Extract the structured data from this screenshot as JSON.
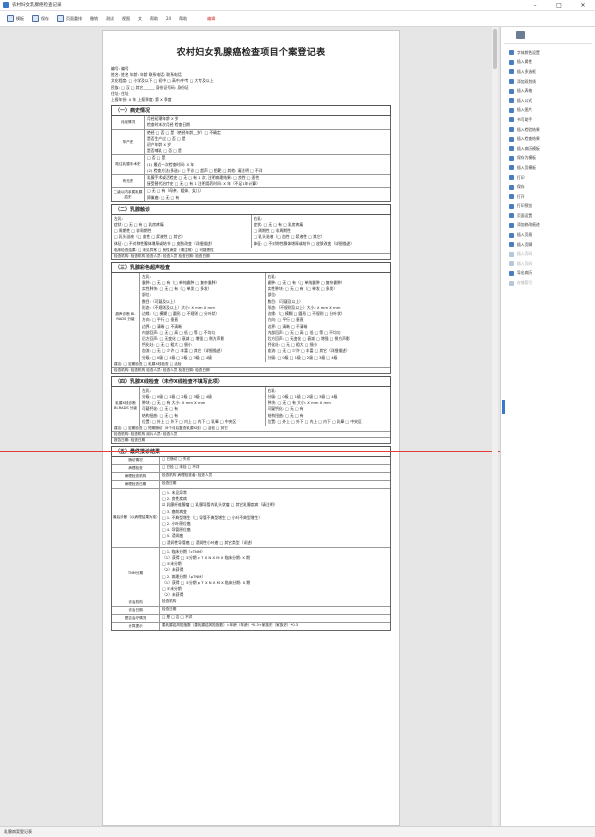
{
  "window": {
    "title": "农村妇女乳腺癌检查记录",
    "minimize": "–",
    "maximize": "□",
    "close": "✕"
  },
  "toolbar": {
    "items": [
      {
        "label": "模板"
      },
      {
        "label": "保存"
      },
      {
        "label": "页面重排"
      },
      {
        "label": "撤销"
      },
      {
        "label": "测试"
      },
      {
        "label": "视图"
      },
      {
        "label": "文"
      },
      {
        "label": "帮助"
      },
      {
        "label": "24"
      },
      {
        "label": "帮助"
      }
    ],
    "red_item": "编辑"
  },
  "document": {
    "title": "农村妇女乳腺癌检查项目个案登记表",
    "header_lines": [
      "编号: 编号",
      "姓名: 姓名            年龄: 年龄            联系电话: 联系电话",
      "文化程度: □ 小学及以下 □ 初中 □ 高中/中专 □ 大专及以上",
      "民族: □ 汉 □ 其它______          身份证号码: 身份证",
      "住址: 住址",
      "上报年份: X 年            上报季度: 第 X 季度"
    ],
    "sections": {
      "s1": "（一）病史情况",
      "s2": "（二）乳腺触诊",
      "s3": "（三）乳腺彩色超声检查",
      "s4": "（四）乳腺X线检查（未作X线检查不填写此项）",
      "s5": "（五）最终接诊结果"
    },
    "s1_rows": [
      {
        "label": "月经情况",
        "items": [
          "月经初潮年龄  X  岁",
          "检查时末次月经  检查日期"
        ]
      },
      {
        "label": "孕产史",
        "items": [
          "绝经  □ 否 □ 是（绝经年龄__岁）□ 不确定",
          "是否生产过  □ 否 □ 是",
          "初产年龄  X  岁",
          "是否哺乳  □ 否 □ 是"
        ]
      },
      {
        "label": "既往乳腺手术史",
        "items": [
          "□ 否 □ 是",
          "(1) 最近一次检查时间: X 年",
          "(2) 检查方法(多选): □ 手诊 □ 超声 □ 钼靶 □ 其他: 请注明 □ 不详"
        ]
      },
      {
        "label": "有无史",
        "items": [
          "乳腺手术或活检史  □ 无 □ 有  1  次, 注明病理结果: □ 良性 □ 恶性",
          "接受替代治疗史  □ 无 □ 有  1  注明用药时间: X 年（不足1年计算）"
        ]
      },
      {
        "label": "二级以内亲属乳腺癌史",
        "items": [
          "□ 无 □ 有（母亲、姐妹、女儿）",
          "卵巢癌: □ 无 □ 有"
        ]
      }
    ],
    "s2_left": [
      "左乳:",
      "症状: □ 无 □ 有 □ 乳房疼痛",
      "□ 周期性  □ 非周期性",
      "□ 乳头溢液（□ 血性 □ 浆液性 □ 其它）",
      "体征: □ 不对称性腺体增厚或结节 □ 皮肤改变（详细描述）"
    ],
    "s2_right": [
      "右乳:",
      "症状: □ 无 □ 有 □ 乳房疼痛",
      "□ 周期性  □ 非周期性",
      "□ 乳头溢液（□ 血性 □ 浆液性 □ 其它）",
      "体征: □ 不对称性腺体增厚或结节 □ 皮肤改变（详细描述）"
    ],
    "s2_footer": [
      "临床检查结果: □ 未见异常 □ 良性病变（请注明）□ 可疑恶性",
      "检查机构: 检查机构    检查人员: 检查人员    检查日期: 检查日期"
    ],
    "s3_label": "超声诊断 BI-RADS 分级",
    "s3_left": [
      "左乳:",
      "囊肿: □ 无 □ 有（□ 单纯囊肿 □ 复杂囊肿）",
      "实性肿块: □ 无 □ 有（□ 单发 □ 多发）",
      "部位:",
      "数目:（可疑及以上）",
      "形态:（不规则及以上）大小: X  mm X  mm",
      "边缘:（□ 模糊 □ 圆形 □ 不规则 □ 分叶状）",
      "方向: □ 平行 □ 垂直",
      "边界: □ 清晰 □ 不清晰",
      "内部回声: □ 无 □ 高 □ 低 □ 等 □ 不均匀",
      "后方回声: □ 无变化 □ 衰减 □ 增强 □ 侧方声影",
      "钙化灶: □ 无 □ 粗大 □ 细小",
      "血流: □ 无 □ 少许 □ 丰富 □ 其它（详细描述）",
      "分级: □ 0级 □ 1级 □ 2级 □ 3级 □ 4级"
    ],
    "s3_right": [
      "右乳:",
      "囊肿: □ 无 □ 有（□ 单纯囊肿 □ 复杂囊肿）",
      "实性肿块: □ 无 □ 有（□ 单发 □ 多发）",
      "部位:",
      "数目:（可疑及以上）",
      "形态:（不规则及以上）大小: X  mm X  mm",
      "边缘:（□ 模糊 □ 圆形 □ 不规则 □ 分叶状）",
      "方向: □ 平行 □ 垂直",
      "边界: □ 清晰 □ 不清晰",
      "内部回声: □ 无 □ 高 □ 低 □ 等 □ 不均匀",
      "后方回声: □ 无变化 □ 衰减 □ 增强 □ 侧方声影",
      "钙化灶: □ 无 □ 粗大 □ 细小",
      "血流: □ 无 □ 少许 □ 丰富 □ 其它（详细描述）",
      "分级: □ 0级 □ 1级 □ 2级 □ 3级 □ 4级"
    ],
    "s3_footer": [
      "建议: □ 定期检查 □ 乳腺X线检查 □ 活检",
      "检查机构: 检查机构    检查人员: 检查人员    检查日期: 检查日期"
    ],
    "s4_label": "乳腺X线诊断 BI-RADS 分级",
    "s4_left": [
      "左乳:",
      "分级: □ 0级 □ 1级 □ 2级 □ 3级 □ 4级",
      "肿块: □ 无 □ 有    大小: X  mm X  mm",
      "可疑钙化: □ 无 □ 有",
      "结构扭曲: □ 无 □ 有",
      "位置: □ 外上 □ 外下 □ 内上 □ 内下 □ 乳晕 □ 中央区"
    ],
    "s4_right": [
      "右乳:",
      "分级: □ 0级 □ 1级 □ 2级 □ 3级 □ 4级",
      "肿块: □ 无 □ 有    大小: X  mm X  mm",
      "可疑钙化: □ 无 □ 有",
      "结构扭曲: □ 无 □ 有",
      "位置: □ 外上 □ 外下 □ 内上 □ 内下 □ 乳晕 □ 中央区"
    ],
    "s4_footer": [
      "建议: □ 定期检查 □ 短期随访（6个月后复查乳腺X线）□ 活检 □ 其它",
      "检查机构: 检查机构                        阅片人员: 检查人员",
      "报告日期: 检查日期"
    ],
    "s5_rows": [
      {
        "label": "随访情况",
        "text": "□ 已随访 □ 失访"
      },
      {
        "label": "病理检查",
        "text": "□ 已检 □ 未检 □ 不详"
      },
      {
        "label": "病理检查机构",
        "text": "检查机构                     病理检查者: 检查人员"
      },
      {
        "label": "病理检查日期",
        "text": "检查日期"
      }
    ],
    "s5_diag_label": "最后诊断（以病理结果为准）",
    "s5_diag": [
      "□ 1. 未见异常",
      "□ 2. 良性疾病",
      "☑ 乳腺纤维腺瘤 □ 乳腺导管内乳头状瘤 □ 其它乳腺疾病（请注明）",
      "□ 3. 癌前病变",
      "□ 1. 不典型增生（□ 导管不典型增生 □ 小叶不典型增生）",
      "□ 2. 小叶原位癌",
      "□ 4. 导管原位癌",
      "□ 5. 浸润癌",
      "□ 浸润性导管癌 □ 浸润性小叶癌 □ 其它类型（详述）"
    ],
    "s5_tnm_label": "TNM分期",
    "s5_tnm": [
      "□ 1. 临床分期（cTNM）",
      "（1）获得 □ ①分期 c T X N X M X  临床分期: X  期",
      "□ ②未分期",
      "（2）未获得",
      "□ 2. 病理分期（pTNM）",
      "（1）获得 □ ①分期 p T X N X M X  临床分期: X  期",
      "□ ②未分期",
      "（2）未获得"
    ],
    "s5_footer": [
      {
        "label": "诊治机构",
        "text": "检查机构"
      },
      {
        "label": "诊治日期",
        "text": "检查日期"
      },
      {
        "label": "是否治疗情况",
        "text": "□ 是 □ 否 □ 不详"
      },
      {
        "label": "计算提示",
        "text": "患乳腺癌风险指数（患乳腺癌风险指数）=年龄（年龄）*0.3+家族史（家族史）*0.3"
      }
    ]
  },
  "right_panel": {
    "items": [
      {
        "label": "字体颜色设置",
        "enabled": true
      },
      {
        "label": "插入属性",
        "enabled": true
      },
      {
        "label": "插入多选框",
        "enabled": true
      },
      {
        "label": "添加双划线",
        "enabled": true
      },
      {
        "label": "插入表格",
        "enabled": true
      },
      {
        "label": "插入公式",
        "enabled": true
      },
      {
        "label": "插入图片",
        "enabled": true
      },
      {
        "label": "书写助手",
        "enabled": true
      },
      {
        "label": "插入检验结果",
        "enabled": true
      },
      {
        "label": "插入检查结果",
        "enabled": true
      },
      {
        "label": "插入病历模板",
        "enabled": true
      },
      {
        "label": "保存为模板",
        "enabled": true
      },
      {
        "label": "插入页模板",
        "enabled": true
      },
      {
        "label": "打印",
        "enabled": true
      },
      {
        "label": "保存",
        "enabled": true
      },
      {
        "label": "打开",
        "enabled": true
      },
      {
        "label": "打印预览",
        "enabled": true
      },
      {
        "label": "页面设置",
        "enabled": true
      },
      {
        "label": "添加修改痕迹",
        "enabled": true
      },
      {
        "label": "插入页眉",
        "enabled": true
      },
      {
        "label": "插入页脚",
        "enabled": true
      },
      {
        "label": "插入页码",
        "enabled": false
      },
      {
        "label": "插入页码",
        "enabled": false
      },
      {
        "label": "导出病历",
        "enabled": true
      },
      {
        "label": "存储索引",
        "enabled": false
      }
    ]
  },
  "status": {
    "text": "乳腺病案登记表"
  }
}
